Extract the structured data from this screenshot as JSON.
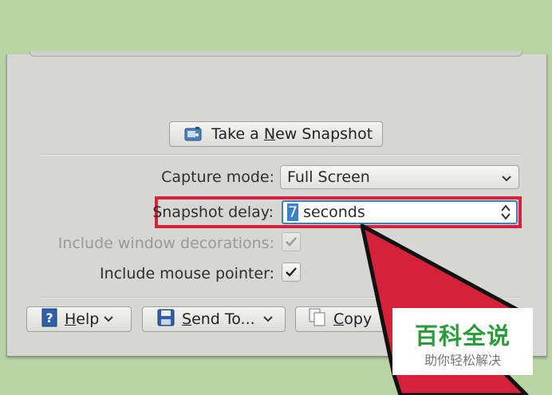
{
  "snapshot_button": {
    "pre": "Take a ",
    "mnemonic": "N",
    "post": "ew Snapshot"
  },
  "capture_mode": {
    "label": "Capture mode:",
    "value": "Full Screen"
  },
  "snapshot_delay": {
    "label": "Snapshot delay:",
    "value": "7",
    "unit": "seconds"
  },
  "window_decorations": {
    "label": "Include window decorations:",
    "checked": true,
    "enabled": false
  },
  "mouse_pointer": {
    "label": "Include mouse pointer:",
    "checked": true
  },
  "bottom_buttons": {
    "help": {
      "mnemonic": "H",
      "rest": "elp"
    },
    "send_to": {
      "mnemonic": "S",
      "rest": "end To..."
    },
    "copy": {
      "mnemonic": "C",
      "rest": "opy"
    }
  },
  "watermark": {
    "title": "百科全说",
    "subtitle": "助你轻松解决"
  },
  "colors": {
    "highlight": "#d6213a",
    "background": "#b8d4a4",
    "selection": "#3d7fc6"
  }
}
